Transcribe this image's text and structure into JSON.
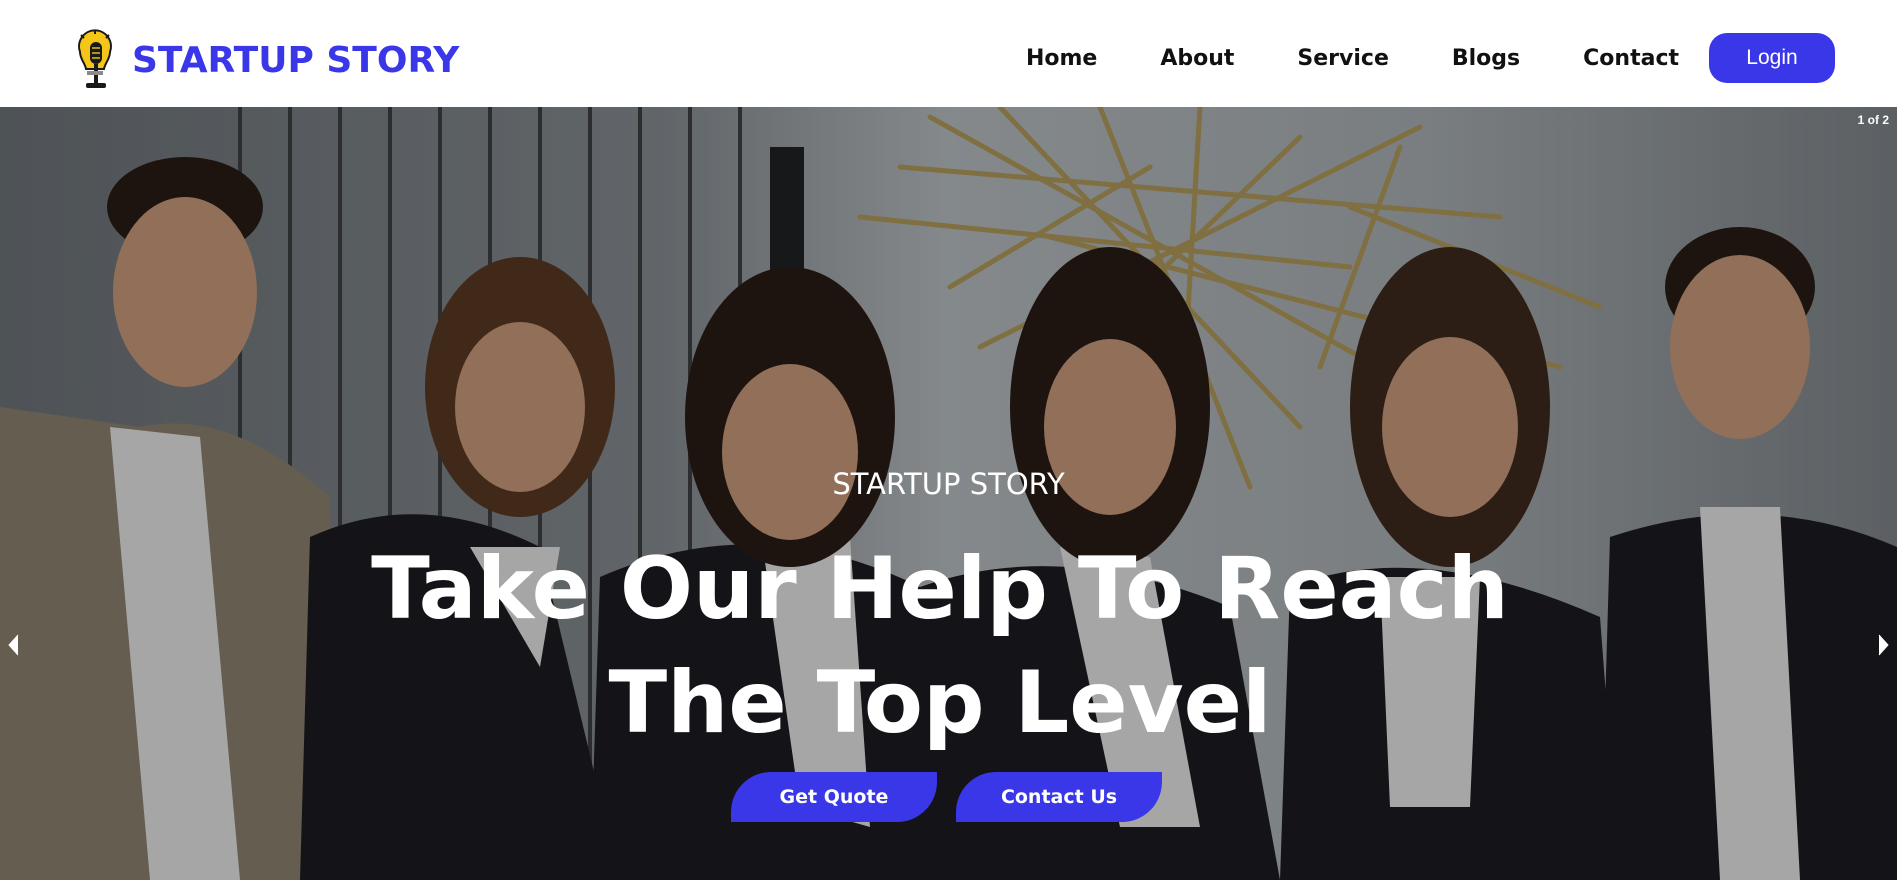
{
  "brand": {
    "name": "STARTUP STORY",
    "logo_icon": "lightbulb-microphone-icon"
  },
  "nav": {
    "items": [
      {
        "label": "Home"
      },
      {
        "label": "About"
      },
      {
        "label": "Service"
      },
      {
        "label": "Blogs"
      },
      {
        "label": "Contact"
      }
    ],
    "login_label": "Login"
  },
  "hero": {
    "slide_counter": "1 of 2",
    "eyebrow": "STARTUP STORY",
    "headline_line1": "Take Our Help To Reach",
    "headline_line2": "The Top Level",
    "buttons": {
      "quote": "Get Quote",
      "contact": "Contact Us"
    },
    "prev_icon": "chevron-left-icon",
    "next_icon": "chevron-right-icon"
  },
  "colors": {
    "accent": "#3a37e8",
    "nav_text": "#111111",
    "hero_text": "#ffffff"
  }
}
